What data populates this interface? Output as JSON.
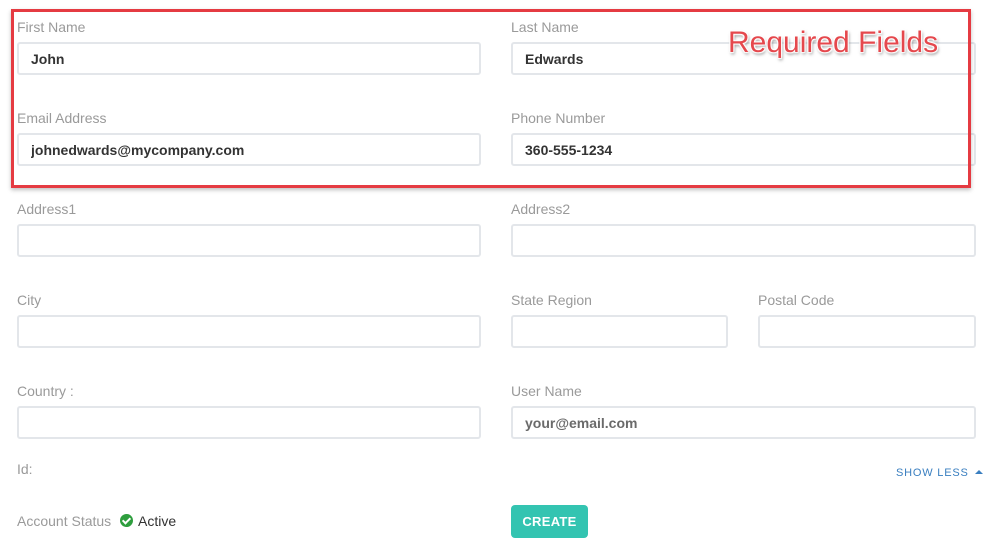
{
  "form": {
    "first_name": {
      "label": "First Name",
      "value": "John"
    },
    "last_name": {
      "label": "Last Name",
      "value": "Edwards"
    },
    "email": {
      "label": "Email Address",
      "value": "johnedwards@mycompany.com"
    },
    "phone": {
      "label": "Phone Number",
      "value": "360-555-1234"
    },
    "address1": {
      "label": "Address1",
      "value": ""
    },
    "address2": {
      "label": "Address2",
      "value": ""
    },
    "city": {
      "label": "City",
      "value": ""
    },
    "state_region": {
      "label": "State Region",
      "value": ""
    },
    "postal_code": {
      "label": "Postal Code",
      "value": ""
    },
    "country": {
      "label": "Country :",
      "value": ""
    },
    "user_name": {
      "label": "User Name",
      "value": "",
      "placeholder": "your@email.com"
    },
    "id": {
      "label": "Id:"
    },
    "account_status": {
      "label": "Account Status",
      "value": "Active",
      "icon": "check-circle-icon",
      "color": "#2e9e3e"
    }
  },
  "actions": {
    "show_less_label": "SHOW LESS",
    "create_label": "CREATE",
    "create_color": "#33c4b1"
  },
  "annotation": {
    "text": "Required Fields",
    "color": "#e53b42"
  }
}
